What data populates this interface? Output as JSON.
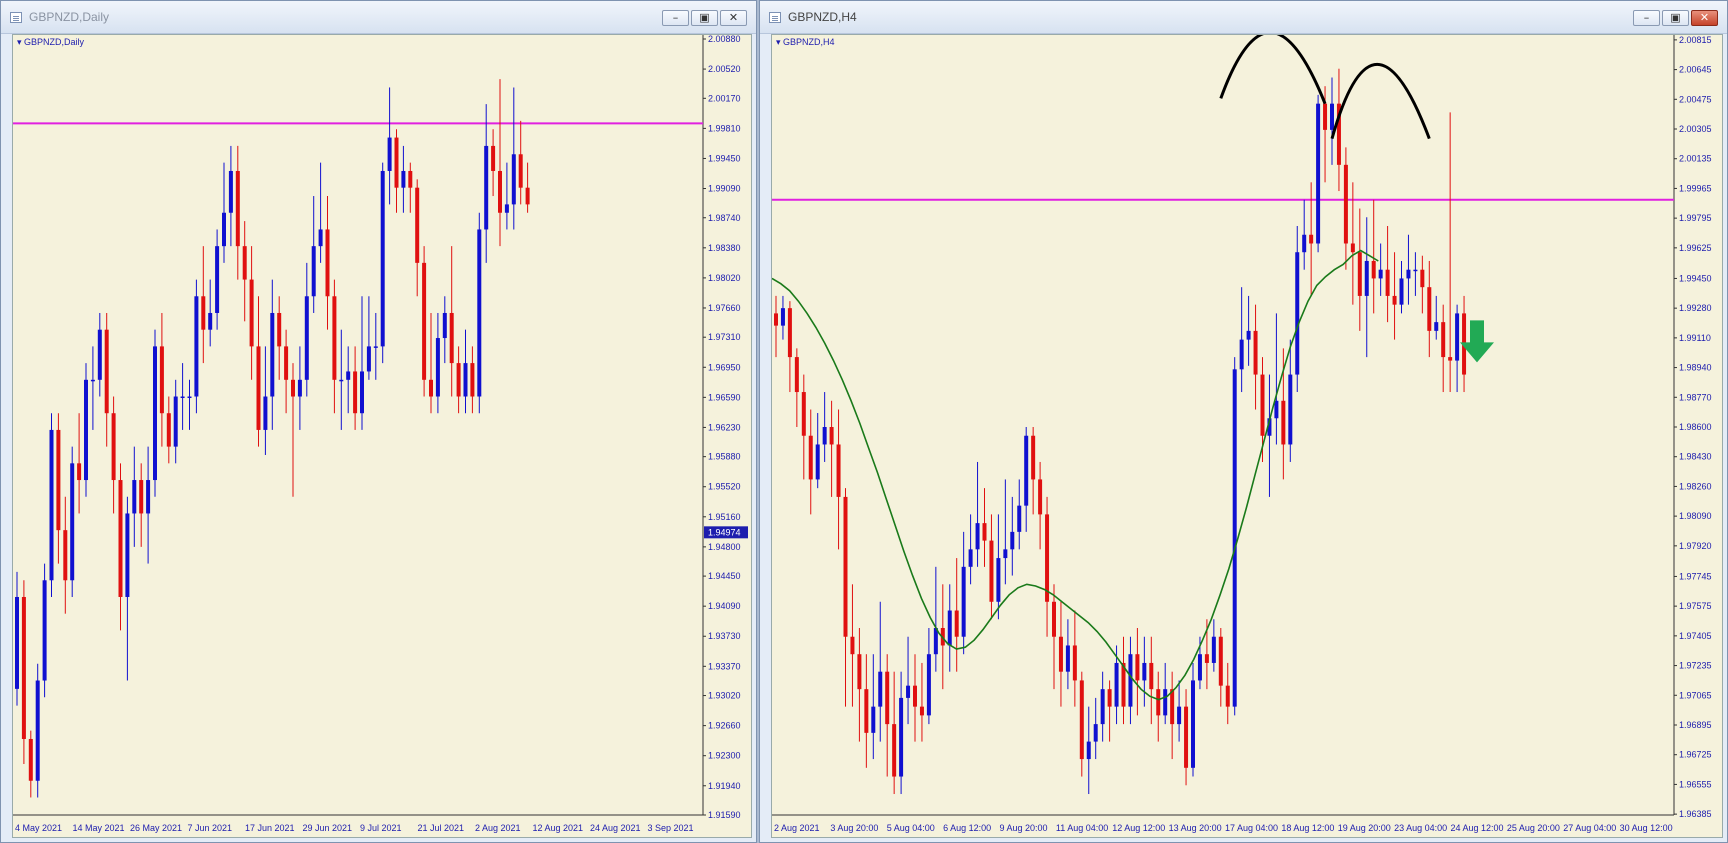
{
  "left_window": {
    "title": "GBPNZD,Daily",
    "chart_label": "GBPNZD,Daily"
  },
  "right_window": {
    "title": "GBPNZD,H4",
    "chart_label": "GBPNZD,H4"
  },
  "window_buttons": {
    "minimize": "–",
    "restore": "▣",
    "close": "✕"
  },
  "colors": {
    "background": "#f5f2dc",
    "bull": "#1010d0",
    "bear": "#e01010",
    "level_line": "#e020e0",
    "moving_average": "#1a7a1a",
    "arrow": "#22aa55",
    "axis_text": "#1d1dae"
  },
  "chart_data": [
    {
      "type": "candlestick",
      "symbol": "GBPNZD",
      "timeframe": "Daily",
      "ylim": [
        1.9159,
        2.0088
      ],
      "y_ticks": [
        "2.00880",
        "2.00520",
        "2.00170",
        "1.99810",
        "1.99450",
        "1.99090",
        "1.98740",
        "1.98380",
        "1.98020",
        "1.97660",
        "1.97310",
        "1.96950",
        "1.96590",
        "1.96230",
        "1.95880",
        "1.95520",
        "1.95160",
        "1.94800",
        "1.94450",
        "1.94090",
        "1.93730",
        "1.93370",
        "1.93020",
        "1.92660",
        "1.92300",
        "1.91940",
        "1.91590"
      ],
      "current_price": "1.94974",
      "horizontal_level": 1.9987,
      "x_labels": [
        "4 May 2021",
        "14 May 2021",
        "26 May 2021",
        "7 Jun 2021",
        "17 Jun 2021",
        "29 Jun 2021",
        "9 Jul 2021",
        "21 Jul 2021",
        "2 Aug 2021",
        "12 Aug 2021",
        "24 Aug 2021",
        "3 Sep 2021"
      ],
      "candles": [
        [
          1.931,
          1.942,
          1.929,
          1.945
        ],
        [
          1.942,
          1.925,
          1.922,
          1.944
        ],
        [
          1.925,
          1.92,
          1.918,
          1.926
        ],
        [
          1.92,
          1.932,
          1.918,
          1.934
        ],
        [
          1.932,
          1.944,
          1.93,
          1.946
        ],
        [
          1.944,
          1.962,
          1.942,
          1.964
        ],
        [
          1.962,
          1.95,
          1.946,
          1.964
        ],
        [
          1.95,
          1.944,
          1.94,
          1.954
        ],
        [
          1.944,
          1.958,
          1.942,
          1.96
        ],
        [
          1.958,
          1.956,
          1.952,
          1.964
        ],
        [
          1.956,
          1.968,
          1.954,
          1.97
        ],
        [
          1.968,
          1.968,
          1.962,
          1.972
        ],
        [
          1.968,
          1.974,
          1.966,
          1.976
        ],
        [
          1.974,
          1.964,
          1.96,
          1.976
        ],
        [
          1.964,
          1.956,
          1.952,
          1.966
        ],
        [
          1.956,
          1.942,
          1.938,
          1.958
        ],
        [
          1.942,
          1.952,
          1.932,
          1.954
        ],
        [
          1.952,
          1.956,
          1.948,
          1.96
        ],
        [
          1.956,
          1.952,
          1.948,
          1.958
        ],
        [
          1.952,
          1.956,
          1.946,
          1.96
        ],
        [
          1.956,
          1.972,
          1.954,
          1.974
        ],
        [
          1.972,
          1.964,
          1.96,
          1.976
        ],
        [
          1.964,
          1.96,
          1.958,
          1.966
        ],
        [
          1.96,
          1.966,
          1.958,
          1.968
        ],
        [
          1.966,
          1.966,
          1.962,
          1.97
        ],
        [
          1.966,
          1.966,
          1.962,
          1.968
        ],
        [
          1.966,
          1.978,
          1.964,
          1.98
        ],
        [
          1.978,
          1.974,
          1.97,
          1.984
        ],
        [
          1.974,
          1.976,
          1.972,
          1.98
        ],
        [
          1.976,
          1.984,
          1.974,
          1.986
        ],
        [
          1.984,
          1.988,
          1.982,
          1.994
        ],
        [
          1.988,
          1.993,
          1.984,
          1.996
        ],
        [
          1.993,
          1.984,
          1.98,
          1.996
        ],
        [
          1.984,
          1.98,
          1.975,
          1.987
        ],
        [
          1.98,
          1.972,
          1.968,
          1.984
        ],
        [
          1.972,
          1.962,
          1.96,
          1.978
        ],
        [
          1.962,
          1.966,
          1.959,
          1.972
        ],
        [
          1.966,
          1.976,
          1.962,
          1.98
        ],
        [
          1.976,
          1.972,
          1.968,
          1.978
        ],
        [
          1.972,
          1.968,
          1.964,
          1.974
        ],
        [
          1.968,
          1.966,
          1.954,
          1.97
        ],
        [
          1.966,
          1.968,
          1.962,
          1.972
        ],
        [
          1.968,
          1.978,
          1.966,
          1.982
        ],
        [
          1.978,
          1.984,
          1.976,
          1.99
        ],
        [
          1.984,
          1.986,
          1.982,
          1.994
        ],
        [
          1.986,
          1.978,
          1.974,
          1.99
        ],
        [
          1.978,
          1.968,
          1.964,
          1.98
        ],
        [
          1.968,
          1.968,
          1.962,
          1.974
        ],
        [
          1.968,
          1.969,
          1.964,
          1.972
        ],
        [
          1.969,
          1.964,
          1.962,
          1.972
        ],
        [
          1.964,
          1.969,
          1.962,
          1.978
        ],
        [
          1.969,
          1.972,
          1.968,
          1.978
        ],
        [
          1.972,
          1.972,
          1.968,
          1.976
        ],
        [
          1.972,
          1.993,
          1.97,
          1.994
        ],
        [
          1.993,
          1.997,
          1.989,
          2.003
        ],
        [
          1.997,
          1.991,
          1.988,
          1.998
        ],
        [
          1.991,
          1.993,
          1.988,
          1.996
        ],
        [
          1.993,
          1.991,
          1.988,
          1.994
        ],
        [
          1.991,
          1.982,
          1.978,
          1.992
        ],
        [
          1.982,
          1.968,
          1.966,
          1.984
        ],
        [
          1.968,
          1.966,
          1.964,
          1.976
        ],
        [
          1.966,
          1.973,
          1.964,
          1.976
        ],
        [
          1.973,
          1.976,
          1.97,
          1.978
        ],
        [
          1.976,
          1.97,
          1.966,
          1.984
        ],
        [
          1.97,
          1.966,
          1.964,
          1.972
        ],
        [
          1.966,
          1.97,
          1.964,
          1.974
        ],
        [
          1.97,
          1.966,
          1.964,
          1.972
        ],
        [
          1.966,
          1.986,
          1.964,
          1.988
        ],
        [
          1.986,
          1.996,
          1.982,
          2.001
        ],
        [
          1.996,
          1.993,
          1.99,
          1.998
        ],
        [
          1.993,
          1.988,
          1.984,
          2.004
        ],
        [
          1.988,
          1.989,
          1.986,
          1.994
        ],
        [
          1.989,
          1.995,
          1.986,
          2.003
        ],
        [
          1.995,
          1.991,
          1.989,
          1.999
        ],
        [
          1.991,
          1.989,
          1.988,
          1.994
        ]
      ]
    },
    {
      "type": "candlestick",
      "symbol": "GBPNZD",
      "timeframe": "H4",
      "ylim": [
        1.9638,
        2.0082
      ],
      "y_ticks": [
        "2.00815",
        "2.00645",
        "2.00475",
        "2.00305",
        "2.00135",
        "1.99965",
        "1.99795",
        "1.99625",
        "1.99450",
        "1.99280",
        "1.99110",
        "1.98940",
        "1.98770",
        "1.98600",
        "1.98430",
        "1.98260",
        "1.98090",
        "1.97920",
        "1.97745",
        "1.97575",
        "1.97405",
        "1.97235",
        "1.97065",
        "1.96895",
        "1.96725",
        "1.96555",
        "1.96385"
      ],
      "horizontal_level": 1.999,
      "x_labels": [
        "2 Aug 2021",
        "3 Aug 20:00",
        "5 Aug 04:00",
        "6 Aug 12:00",
        "9 Aug 20:00",
        "11 Aug 04:00",
        "12 Aug 12:00",
        "13 Aug 20:00",
        "17 Aug 04:00",
        "18 Aug 12:00",
        "19 Aug 20:00",
        "23 Aug 04:00",
        "24 Aug 12:00",
        "25 Aug 20:00",
        "27 Aug 04:00",
        "30 Aug 12:00"
      ],
      "candles": [
        [
          1.9925,
          1.9918,
          1.99,
          1.9935
        ],
        [
          1.9918,
          1.9928,
          1.991,
          1.9935
        ],
        [
          1.9928,
          1.99,
          1.988,
          1.9932
        ],
        [
          1.99,
          1.988,
          1.986,
          1.9905
        ],
        [
          1.988,
          1.9855,
          1.983,
          1.989
        ],
        [
          1.9855,
          1.983,
          1.981,
          1.987
        ],
        [
          1.983,
          1.985,
          1.9825,
          1.9868
        ],
        [
          1.985,
          1.986,
          1.984,
          1.988
        ],
        [
          1.986,
          1.985,
          1.982,
          1.9875
        ],
        [
          1.985,
          1.982,
          1.979,
          1.987
        ],
        [
          1.982,
          1.974,
          1.97,
          1.9825
        ],
        [
          1.974,
          1.973,
          1.97,
          1.977
        ],
        [
          1.973,
          1.971,
          1.968,
          1.9745
        ],
        [
          1.971,
          1.9685,
          1.9665,
          1.973
        ],
        [
          1.9685,
          1.97,
          1.967,
          1.973
        ],
        [
          1.97,
          1.972,
          1.968,
          1.976
        ],
        [
          1.972,
          1.969,
          1.966,
          1.973
        ],
        [
          1.969,
          1.966,
          1.965,
          1.972
        ],
        [
          1.966,
          1.9705,
          1.965,
          1.972
        ],
        [
          1.9705,
          1.9712,
          1.969,
          1.974
        ],
        [
          1.9712,
          1.97,
          1.968,
          1.973
        ],
        [
          1.97,
          1.9695,
          1.968,
          1.9725
        ],
        [
          1.9695,
          1.973,
          1.969,
          1.9745
        ],
        [
          1.973,
          1.9745,
          1.972,
          1.978
        ],
        [
          1.9745,
          1.9735,
          1.971,
          1.977
        ],
        [
          1.9735,
          1.9755,
          1.972,
          1.977
        ],
        [
          1.9755,
          1.974,
          1.972,
          1.9785
        ],
        [
          1.974,
          1.978,
          1.973,
          1.98
        ],
        [
          1.978,
          1.979,
          1.977,
          1.981
        ],
        [
          1.979,
          1.9805,
          1.978,
          1.984
        ],
        [
          1.9805,
          1.9795,
          1.978,
          1.9825
        ],
        [
          1.9795,
          1.976,
          1.975,
          1.981
        ],
        [
          1.976,
          1.9785,
          1.975,
          1.981
        ],
        [
          1.9785,
          1.979,
          1.977,
          1.983
        ],
        [
          1.979,
          1.98,
          1.9775,
          1.982
        ],
        [
          1.98,
          1.9815,
          1.979,
          1.983
        ],
        [
          1.9815,
          1.9855,
          1.98,
          1.986
        ],
        [
          1.9855,
          1.983,
          1.981,
          1.986
        ],
        [
          1.983,
          1.981,
          1.979,
          1.984
        ],
        [
          1.981,
          1.976,
          1.974,
          1.982
        ],
        [
          1.976,
          1.974,
          1.971,
          1.977
        ],
        [
          1.974,
          1.972,
          1.97,
          1.976
        ],
        [
          1.972,
          1.9735,
          1.971,
          1.975
        ],
        [
          1.9735,
          1.9715,
          1.97,
          1.9755
        ],
        [
          1.9715,
          1.967,
          1.966,
          1.972
        ],
        [
          1.967,
          1.968,
          1.965,
          1.97
        ],
        [
          1.968,
          1.969,
          1.967,
          1.9705
        ],
        [
          1.969,
          1.971,
          1.968,
          1.972
        ],
        [
          1.971,
          1.97,
          1.968,
          1.9715
        ],
        [
          1.97,
          1.9725,
          1.969,
          1.9735
        ],
        [
          1.9725,
          1.97,
          1.969,
          1.974
        ],
        [
          1.97,
          1.973,
          1.969,
          1.974
        ],
        [
          1.973,
          1.9715,
          1.9695,
          1.9745
        ],
        [
          1.9715,
          1.9725,
          1.97,
          1.974
        ],
        [
          1.9725,
          1.971,
          1.969,
          1.974
        ],
        [
          1.971,
          1.9695,
          1.968,
          1.972
        ],
        [
          1.9695,
          1.971,
          1.969,
          1.9725
        ],
        [
          1.971,
          1.969,
          1.967,
          1.972
        ],
        [
          1.969,
          1.97,
          1.968,
          1.9715
        ],
        [
          1.97,
          1.9665,
          1.9655,
          1.971
        ],
        [
          1.9665,
          1.9715,
          1.966,
          1.9725
        ],
        [
          1.9715,
          1.973,
          1.971,
          1.974
        ],
        [
          1.973,
          1.9725,
          1.971,
          1.975
        ],
        [
          1.9725,
          1.974,
          1.972,
          1.975
        ],
        [
          1.974,
          1.9712,
          1.97,
          1.9745
        ],
        [
          1.9712,
          1.97,
          1.969,
          1.9725
        ],
        [
          1.97,
          1.9893,
          1.9695,
          1.99
        ],
        [
          1.9893,
          1.991,
          1.988,
          1.994
        ],
        [
          1.991,
          1.9915,
          1.9895,
          1.9935
        ],
        [
          1.9915,
          1.989,
          1.987,
          1.993
        ],
        [
          1.989,
          1.9855,
          1.984,
          1.99
        ],
        [
          1.9855,
          1.9865,
          1.982,
          1.989
        ],
        [
          1.9865,
          1.9875,
          1.985,
          1.9925
        ],
        [
          1.9875,
          1.985,
          1.983,
          1.9905
        ],
        [
          1.985,
          1.989,
          1.984,
          1.991
        ],
        [
          1.989,
          1.996,
          1.988,
          1.9975
        ],
        [
          1.996,
          1.997,
          1.995,
          1.999
        ],
        [
          1.997,
          1.9965,
          1.9935,
          2.0
        ],
        [
          1.9965,
          2.0045,
          1.996,
          2.005
        ],
        [
          2.0045,
          2.003,
          2.0,
          2.0055
        ],
        [
          2.003,
          2.0045,
          2.001,
          2.006
        ],
        [
          2.0045,
          2.001,
          1.9995,
          2.0065
        ],
        [
          2.001,
          1.9965,
          1.995,
          2.002
        ],
        [
          1.9965,
          1.996,
          1.993,
          2.0
        ],
        [
          1.996,
          1.9935,
          1.9915,
          1.9985
        ],
        [
          1.9935,
          1.9955,
          1.99,
          1.998
        ],
        [
          1.9955,
          1.9945,
          1.9925,
          1.999
        ],
        [
          1.9945,
          1.995,
          1.9935,
          1.9965
        ],
        [
          1.995,
          1.9935,
          1.992,
          1.9975
        ],
        [
          1.9935,
          1.993,
          1.991,
          1.996
        ],
        [
          1.993,
          1.9945,
          1.9925,
          1.9955
        ],
        [
          1.9945,
          1.995,
          1.993,
          1.997
        ],
        [
          1.995,
          1.995,
          1.9935,
          1.996
        ],
        [
          1.995,
          1.994,
          1.9925,
          1.9958
        ],
        [
          1.994,
          1.9915,
          1.99,
          1.9955
        ],
        [
          1.9915,
          1.992,
          1.991,
          1.9935
        ],
        [
          1.992,
          1.99,
          1.988,
          1.993
        ],
        [
          1.99,
          1.9898,
          1.988,
          2.004
        ],
        [
          1.9898,
          1.9925,
          1.988,
          1.993
        ],
        [
          1.9925,
          1.989,
          1.988,
          1.9935
        ]
      ],
      "moving_average": [
        1.9945,
        1.9942,
        1.9938,
        1.9932,
        1.9925,
        1.9917,
        1.9908,
        1.9898,
        1.9887,
        1.9875,
        1.9862,
        1.9848,
        1.9834,
        1.9819,
        1.9804,
        1.9789,
        1.9775,
        1.9762,
        1.9751,
        1.9742,
        1.9736,
        1.9733,
        1.9734,
        1.9738,
        1.9744,
        1.9751,
        1.9758,
        1.9764,
        1.9768,
        1.977,
        1.9769,
        1.9767,
        1.9764,
        1.976,
        1.9756,
        1.9752,
        1.9748,
        1.9743,
        1.9737,
        1.973,
        1.9723,
        1.9716,
        1.971,
        1.9706,
        1.9704,
        1.9706,
        1.9711,
        1.9718,
        1.9727,
        1.9738,
        1.975,
        1.9764,
        1.9779,
        1.9796,
        1.9814,
        1.9833,
        1.9852,
        1.9871,
        1.9889,
        1.9906,
        1.992,
        1.9932,
        1.9941,
        1.9946,
        1.995,
        1.9953,
        1.9958,
        1.9961,
        1.9958,
        1.9955
      ],
      "annotations": [
        "double-top arcs",
        "down arrow"
      ]
    }
  ]
}
